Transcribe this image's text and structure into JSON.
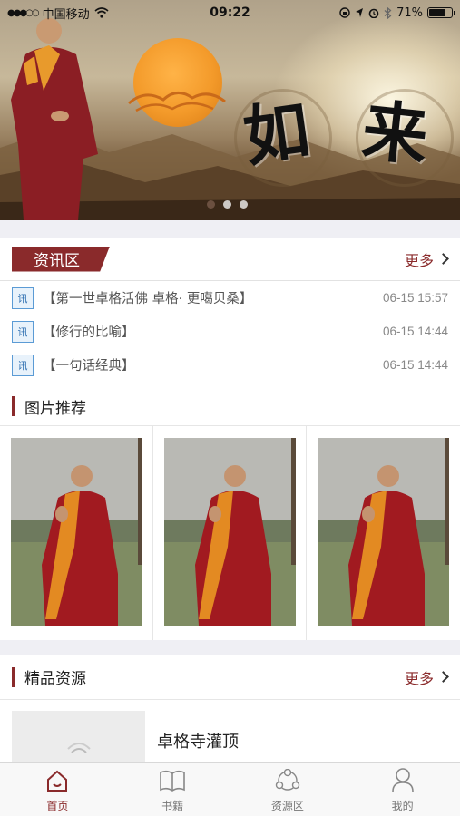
{
  "status_bar": {
    "carrier": "中国移动",
    "time": "09:22",
    "battery": "71%"
  },
  "banner": {
    "calligraphy": [
      "如",
      "来"
    ],
    "pages": 3,
    "active_page": 1
  },
  "news": {
    "tag": "资讯区",
    "more": "更多",
    "icon_char": "讯",
    "items": [
      {
        "title": "【第一世卓格活佛 卓格· 更噶贝桑】",
        "time": "06-15 15:57"
      },
      {
        "title": "【修行的比喻】",
        "time": "06-15 14:44"
      },
      {
        "title": "【一句话经典】",
        "time": "06-15 14:44"
      }
    ]
  },
  "pictures": {
    "title": "图片推荐"
  },
  "resources": {
    "title": "精品资源",
    "more": "更多",
    "items": [
      {
        "title": "卓格寺灌顶"
      }
    ]
  },
  "tabs": [
    {
      "label": "首页",
      "icon": "home-icon",
      "active": true
    },
    {
      "label": "书籍",
      "icon": "book-icon",
      "active": false
    },
    {
      "label": "资源区",
      "icon": "resource-icon",
      "active": false
    },
    {
      "label": "我的",
      "icon": "user-icon",
      "active": false
    }
  ],
  "colors": {
    "accent": "#8a2a2b",
    "background": "#efeff4"
  }
}
